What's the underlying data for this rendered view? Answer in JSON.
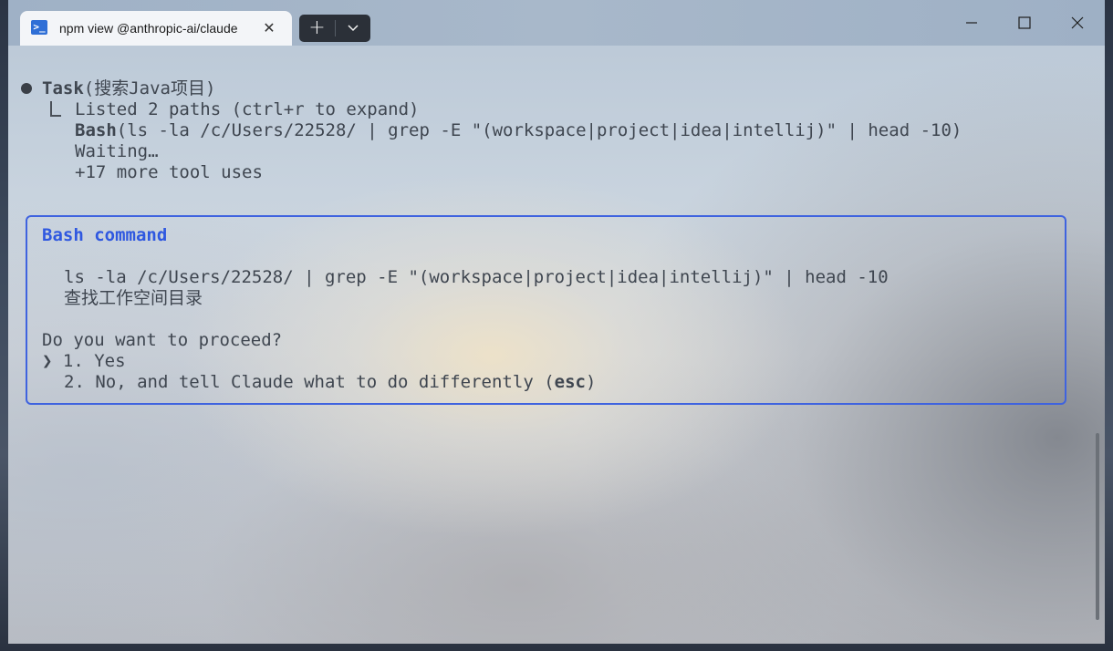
{
  "window": {
    "tab_title": "npm view @anthropic-ai/claude",
    "tab_icon": "powershell-icon",
    "caption": {
      "minimize": "minimize-icon",
      "maximize": "maximize-icon",
      "close": "close-icon"
    },
    "new_tab_glyph": "+"
  },
  "task": {
    "name": "Task",
    "args": "(搜索Java项目)",
    "listed": "Listed 2 paths (ctrl+r to expand)",
    "bash_label": "Bash",
    "bash_args": "(ls -la /c/Users/22528/ | grep -E \"(workspace|project|idea|intellij)\" | head -10)",
    "waiting": "Waiting…",
    "more": "+17 more tool uses"
  },
  "prompt": {
    "title": "Bash command",
    "command": "ls -la /c/Users/22528/ | grep -E \"(workspace|project|idea|intellij)\" | head -10",
    "description": "查找工作空间目录",
    "question": "Do you want to proceed?",
    "cursor": "❯",
    "option1": "1. Yes",
    "option2_prefix": "2. No, and tell Claude what to do differently (",
    "option2_key": "esc",
    "option2_suffix": ")"
  },
  "colors": {
    "accent": "#3f63df",
    "text": "#3f4650"
  }
}
